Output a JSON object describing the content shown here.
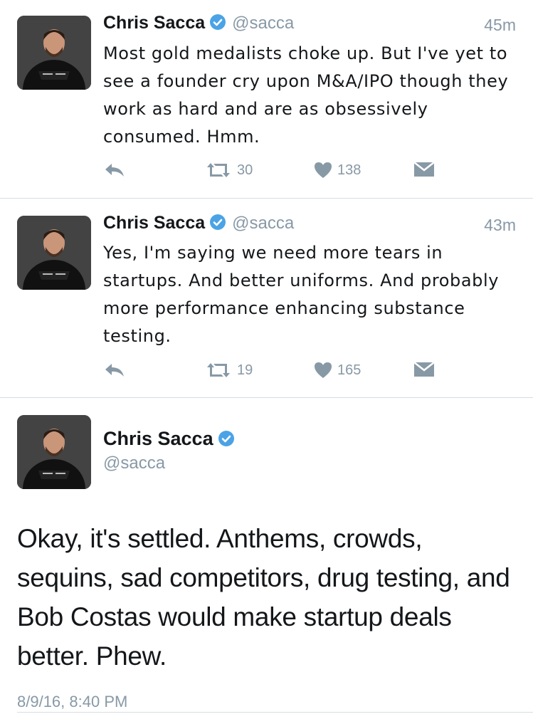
{
  "tweets": [
    {
      "author_name": "Chris Sacca",
      "handle": "@sacca",
      "time": "45m",
      "text": "Most gold medalists choke up. But I've yet to see a founder cry upon M&A/IPO though they work as hard and are as obsessively consumed. Hmm.",
      "retweets": "30",
      "likes": "138"
    },
    {
      "author_name": "Chris Sacca",
      "handle": "@sacca",
      "time": "43m",
      "text": "Yes, I'm saying we need more tears in startups. And better uniforms. And probably more performance enhancing substance testing.",
      "retweets": "19",
      "likes": "165"
    }
  ],
  "main_tweet": {
    "author_name": "Chris Sacca",
    "handle": "@sacca",
    "text": "Okay, it's settled. Anthems, crowds, sequins, sad competitors, drug testing, and Bob Costas would make startup deals better. Phew.",
    "timestamp": "8/9/16, 8:40 PM"
  },
  "icons": {
    "reply": "reply-icon",
    "retweet": "retweet-icon",
    "like": "heart-icon",
    "dm": "envelope-icon",
    "verified": "verified-badge-icon"
  },
  "colors": {
    "verified": "#4ba3e6",
    "muted": "#8899a6",
    "text": "#14171a",
    "divider": "#d8dde1"
  }
}
